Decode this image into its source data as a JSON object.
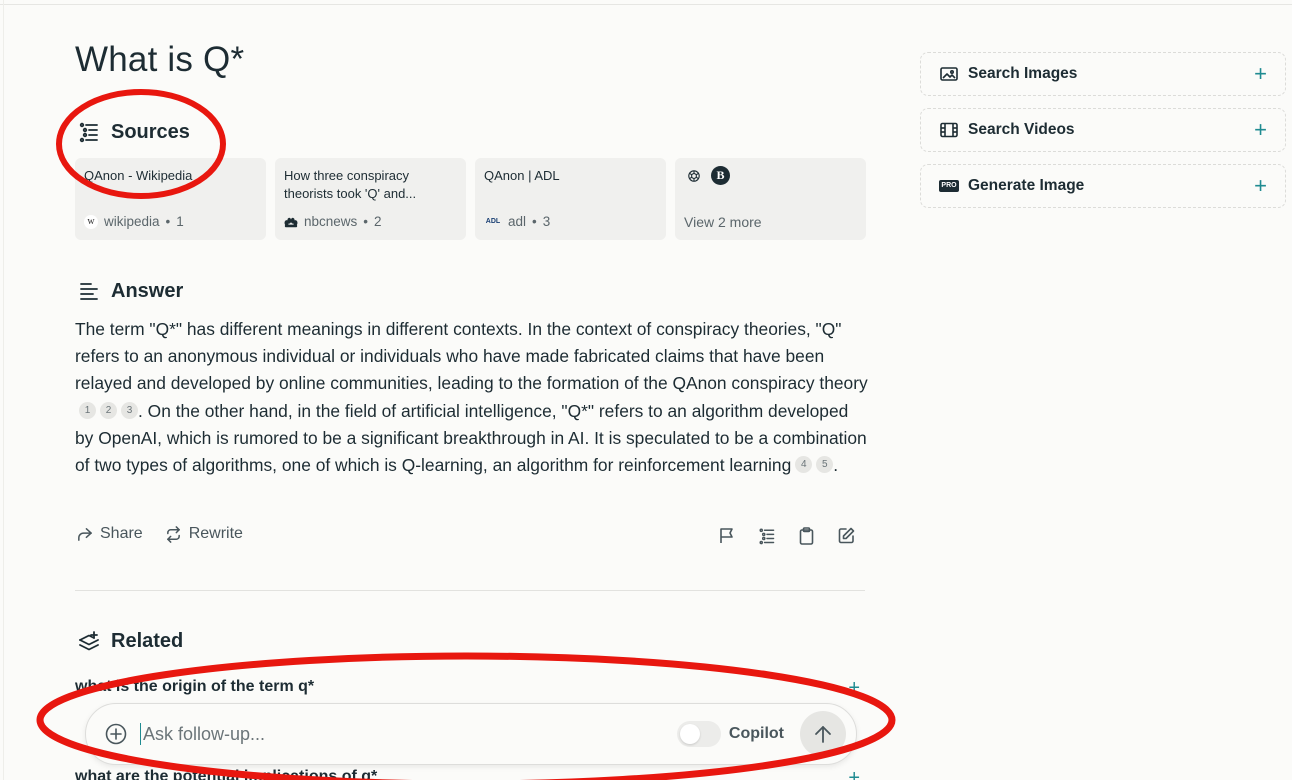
{
  "page": {
    "title": "What is Q*"
  },
  "sources": {
    "heading": "Sources",
    "cards": [
      {
        "title": "QAnon - Wikipedia",
        "domain": "wikipedia",
        "index": "1",
        "favicon": "W"
      },
      {
        "title": "How three conspiracy theorists took 'Q' and...",
        "domain": "nbcnews",
        "index": "2",
        "favicon": "peacock"
      },
      {
        "title": "QAnon | ADL",
        "domain": "adl",
        "index": "3",
        "favicon": "ADL"
      }
    ],
    "view_more": "View 2 more",
    "more_icons": [
      "openai-icon",
      "B"
    ]
  },
  "answer": {
    "heading": "Answer",
    "p1": "The term \"Q*\" has different meanings in different contexts. In the context of conspiracy theories, \"Q\" refers to an anonymous individual or individuals who have made fabricated claims that have been relayed and developed by online communities, leading to the formation of the QAnon conspiracy theory",
    "cites1": [
      "1",
      "2",
      "3"
    ],
    "p2": ". On the other hand, in the field of artificial intelligence, \"Q*\" refers to an algorithm developed by OpenAI, which is rumored to be a significant breakthrough in AI. It is speculated to be a combination of two types of algorithms, one of which is Q-learning, an algorithm for reinforcement learning",
    "cites2": [
      "4",
      "5"
    ],
    "p3": "."
  },
  "actions": {
    "share": "Share",
    "rewrite": "Rewrite"
  },
  "related": {
    "heading": "Related",
    "items": [
      "what is the origin of the term q*",
      "what are the potential implications of q*"
    ]
  },
  "followup": {
    "placeholder": "Ask follow-up...",
    "copilot_label": "Copilot",
    "copilot_enabled": false
  },
  "sidebar": {
    "items": [
      {
        "label": "Search Images",
        "icon": "image-icon"
      },
      {
        "label": "Search Videos",
        "icon": "film-icon"
      },
      {
        "label": "Generate Image",
        "icon": "pro-badge-icon",
        "badge": "PRO"
      }
    ]
  },
  "colors": {
    "accent": "#1f8b91",
    "annotation": "#e8170f",
    "card": "#f0f0ee",
    "text": "#1d2c33"
  }
}
